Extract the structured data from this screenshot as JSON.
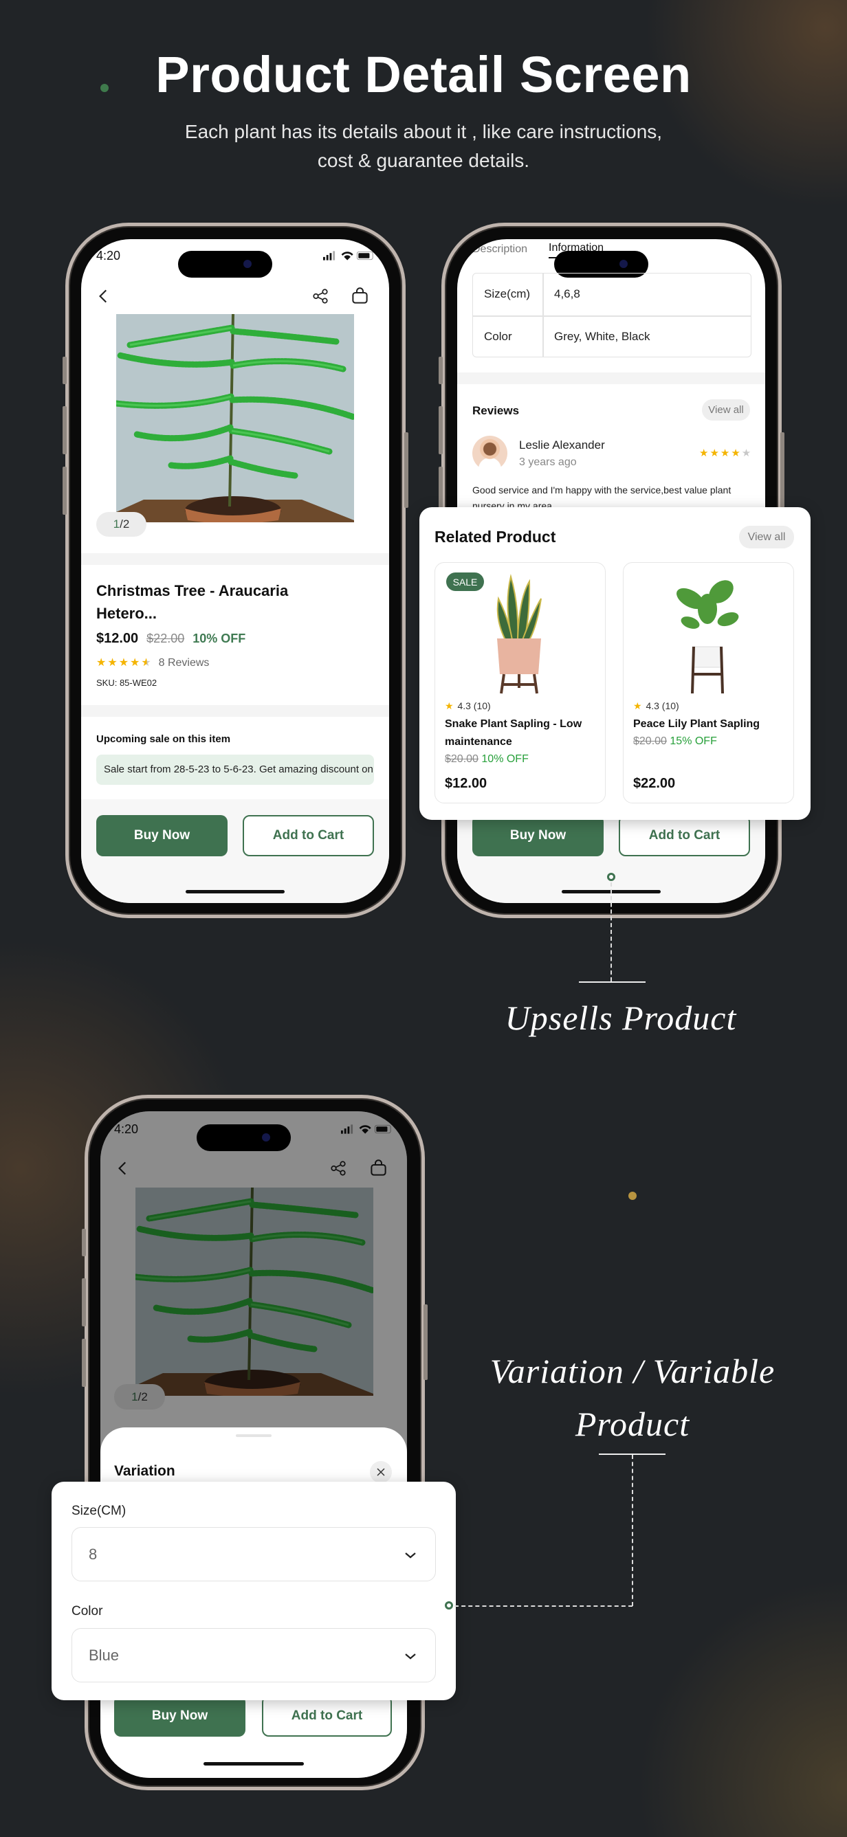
{
  "header": {
    "title": "Product Detail Screen",
    "subtitle_line1": "Each plant has its details about it , like care instructions,",
    "subtitle_line2": "cost & guarantee details."
  },
  "colors": {
    "accent": "#3f7250",
    "background": "#212427",
    "discount_green": "#27a03a",
    "star": "#f4b400"
  },
  "phone1": {
    "status_time": "4:20",
    "icons": [
      "back-chevron-icon",
      "share-icon",
      "shopping-bag-icon"
    ],
    "pager": {
      "current": "1",
      "separator": " / ",
      "total": "2"
    },
    "product_title_line1": "Christmas Tree - Araucaria",
    "product_title_line2": "Hetero...",
    "price": "$12.00",
    "old_price": "$22.00",
    "discount": "10% OFF",
    "rating": 4.5,
    "stars": "★★★★",
    "half_star": "★",
    "reviews": "8 Reviews",
    "sku": "SKU: 85-WE02",
    "upcoming_title": "Upcoming sale on this item",
    "upcoming_text": "Sale start from 28-5-23 to 5-6-23. Get amazing discount on",
    "buy_now": "Buy Now",
    "add_to_cart": "Add to Cart"
  },
  "phone2": {
    "tabs": [
      {
        "label": "Description",
        "active": false
      },
      {
        "label": "Information",
        "active": true
      }
    ],
    "info_table": [
      {
        "key": "Size(cm)",
        "value": "4,6,8"
      },
      {
        "key": "Color",
        "value": "Grey, White, Black"
      }
    ],
    "reviews_title": "Reviews",
    "view_all": "View all",
    "review": {
      "name": "Leslie Alexander",
      "time": "3 years ago",
      "rating": 4,
      "stars": "★★★★",
      "empty_star": "★",
      "text_line1": "Good service and I'm happy with the service,best value plant",
      "text_line2": "nursery in my area"
    },
    "buy_now": "Buy Now",
    "add_to_cart": "Add to Cart"
  },
  "related": {
    "title": "Related Product",
    "view_all": "View all",
    "products": [
      {
        "badge": "SALE",
        "rating": "4.3 (10)",
        "name": "Snake Plant Sapling - Low maintenance",
        "old_price": "$20.00",
        "discount": "10% OFF",
        "price": "$12.00"
      },
      {
        "rating": "4.3 (10)",
        "name": "Peace Lily Plant Sapling",
        "old_price": "$20.00",
        "discount": "15% OFF",
        "price": "$22.00"
      }
    ]
  },
  "annotation_upsell": "Upsells Product",
  "phone3": {
    "status_time": "4:20",
    "pager": {
      "current": "1",
      "separator": " / ",
      "total": "2"
    },
    "sheet_title": "Variation",
    "buy_now": "Buy Now",
    "add_to_cart": "Add to Cart"
  },
  "variation": {
    "size_label": "Size(CM)",
    "size_value": "8",
    "color_label": "Color",
    "color_value": "Blue"
  },
  "annotation_variation_line1": "Variation / Variable",
  "annotation_variation_line2": "Product"
}
